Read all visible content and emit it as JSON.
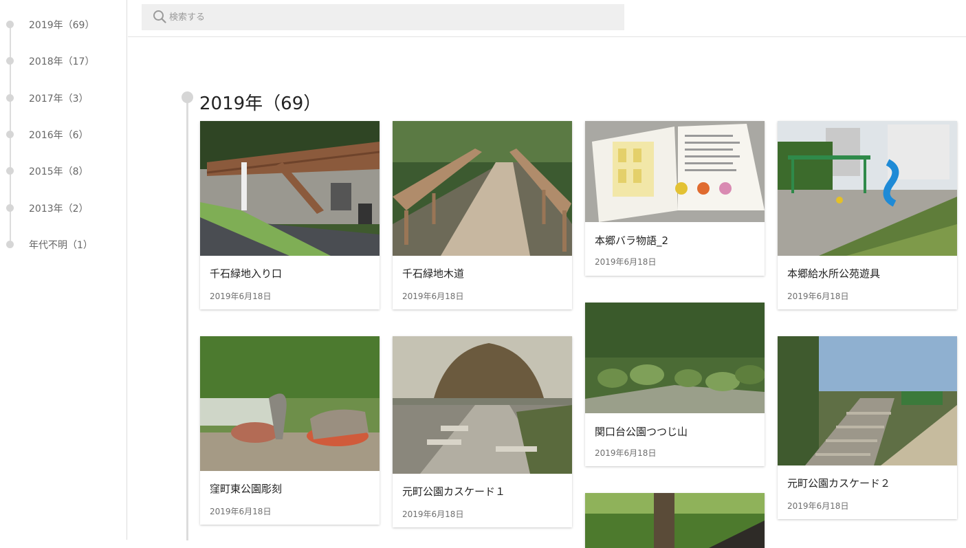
{
  "sidebar": {
    "years": [
      {
        "label": "2019年（69）"
      },
      {
        "label": "2018年（17）"
      },
      {
        "label": "2017年（3）"
      },
      {
        "label": "2016年（6）"
      },
      {
        "label": "2015年（8）"
      },
      {
        "label": "2013年（2）"
      },
      {
        "label": "年代不明（1）"
      }
    ]
  },
  "search": {
    "placeholder": "検索する",
    "icon": "search-icon"
  },
  "section": {
    "title": "2019年（69）"
  },
  "cards": [
    {
      "title": "千石緑地入り口",
      "date": "2019年6月18日"
    },
    {
      "title": "千石緑地木道",
      "date": "2019年6月18日"
    },
    {
      "title": "本郷バラ物語_2",
      "date": "2019年6月18日"
    },
    {
      "title": "本郷給水所公苑遊具",
      "date": "2019年6月18日"
    },
    {
      "title": "窪町東公園彫刻",
      "date": "2019年6月18日"
    },
    {
      "title": "元町公園カスケード１",
      "date": "2019年6月18日"
    },
    {
      "title": "関口台公園つつじ山",
      "date": "2019年6月18日"
    },
    {
      "title": "元町公園カスケード２",
      "date": "2019年6月18日"
    },
    {
      "title": "",
      "date": ""
    }
  ]
}
